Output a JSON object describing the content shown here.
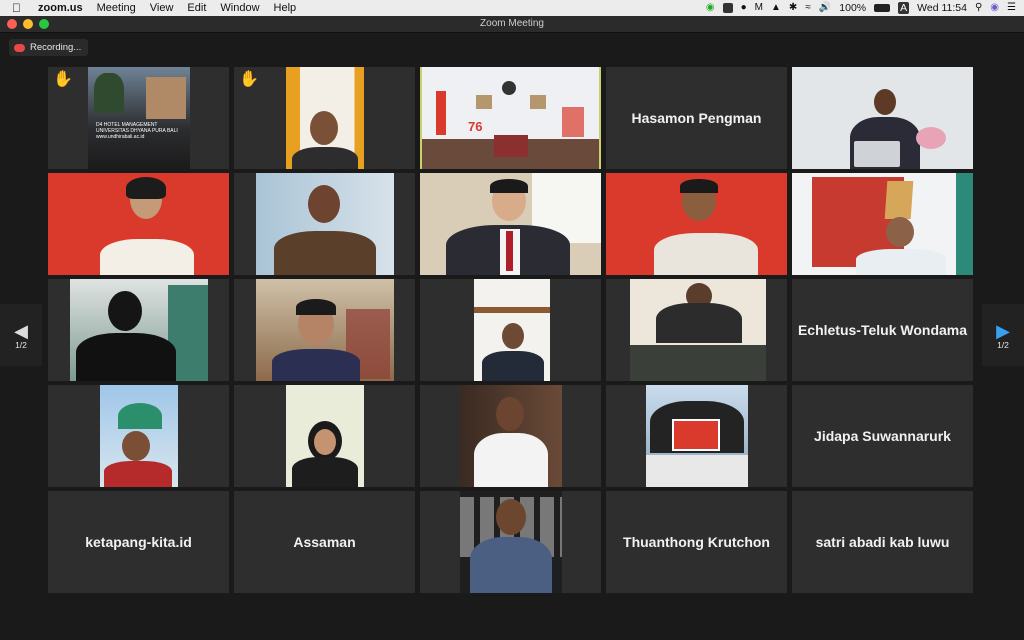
{
  "menubar": {
    "app": "zoom.us",
    "items": [
      "Meeting",
      "View",
      "Edit",
      "Window",
      "Help"
    ],
    "battery": "100%",
    "input_source": "A",
    "clock": "Wed 11:54"
  },
  "window": {
    "title": "Zoom Meeting"
  },
  "recording": {
    "label": "Recording..."
  },
  "pager": {
    "left_label": "1/2",
    "right_label": "1/2"
  },
  "tiles": {
    "r1c4": "Hasamon Pengman",
    "r3c5": "Echletus-Teluk Wondama",
    "r4c5": "Jidapa Suwannarurk",
    "r5c1": "ketapang-kita.id",
    "r5c2": "Assaman",
    "r5c4": "Thuanthong Krutchon",
    "r5c5": "satri abadi kab luwu"
  },
  "video_text": {
    "hotel_lines": [
      "D4 HOTEL MANAGEMENT",
      "UNIVERSITAS DHYANA PURA BALI",
      "www.undhirabali.ac.id"
    ],
    "banner_number": "76"
  },
  "colors": {
    "active_border": "#c9d16a",
    "hand": "#f5c03a",
    "red_banner": "#d93a2b",
    "recording_dot": "#e84848"
  }
}
